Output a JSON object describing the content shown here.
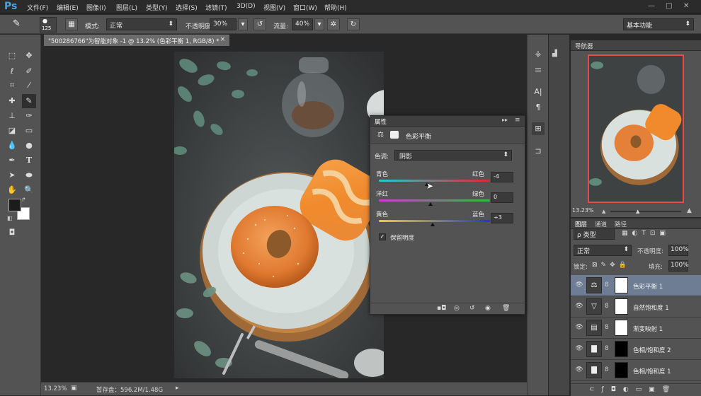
{
  "app": {
    "logo": "Ps"
  },
  "menu": [
    "文件(F)",
    "编辑(E)",
    "图像(I)",
    "图层(L)",
    "类型(Y)",
    "选择(S)",
    "滤镜(T)",
    "3D(D)",
    "视图(V)",
    "窗口(W)",
    "帮助(H)"
  ],
  "window_controls": {
    "minimize": "—",
    "restore": "□",
    "close": "✕"
  },
  "options": {
    "brush_size": "125",
    "mode_label": "模式:",
    "mode_value": "正常",
    "opacity_label": "不透明度:",
    "opacity_value": "30%",
    "flow_label": "流量:",
    "flow_value": "40%",
    "workspace": "基本功能"
  },
  "document": {
    "tab_title": "\"500286766\"为智能对象 -1 @ 13.2% (色彩平衡 1, RGB/8) *",
    "tab_close": "×"
  },
  "status": {
    "zoom": "13.23%",
    "scratch": "暂存盘：596.2M/1.48G"
  },
  "navigator": {
    "tab": "导航器",
    "zoom": "13.23%"
  },
  "layers_panel": {
    "tabs": [
      "图层",
      "通道",
      "路径"
    ],
    "filter_kind": "ρ 类型",
    "blend_mode": "正常",
    "opacity_label": "不透明度:",
    "opacity_value": "100%",
    "lock_label": "锁定:",
    "fill_label": "填充:",
    "fill_value": "100%",
    "layers": [
      {
        "name": "色彩平衡 1",
        "icon": "balance-icon"
      },
      {
        "name": "自然饱和度 1",
        "icon": "vibrance-icon"
      },
      {
        "name": "渐变映射 1",
        "icon": "gradient-map-icon"
      },
      {
        "name": "色相/饱和度 2",
        "icon": "hue-sat-icon"
      },
      {
        "name": "色相/饱和度 1",
        "icon": "hue-sat-icon"
      }
    ]
  },
  "properties": {
    "tab": "属性",
    "title": "色彩平衡",
    "tone_label": "色调:",
    "tone_value": "阴影",
    "sliders": [
      {
        "left": "青色",
        "right": "红色",
        "value": "-4",
        "pos": -4
      },
      {
        "left": "洋红",
        "right": "绿色",
        "value": "0",
        "pos": 0
      },
      {
        "left": "黄色",
        "right": "蓝色",
        "value": "+3",
        "pos": 3
      }
    ],
    "preserve_label": "保留明度",
    "preserve_checked": true
  },
  "colors": {
    "cyan_red": [
      "#25c8d8",
      "#e0282a"
    ],
    "magenta_green": [
      "#d33bd0",
      "#2fbf3c"
    ],
    "yellow_blue": [
      "#e3d22a",
      "#2535c9"
    ]
  }
}
